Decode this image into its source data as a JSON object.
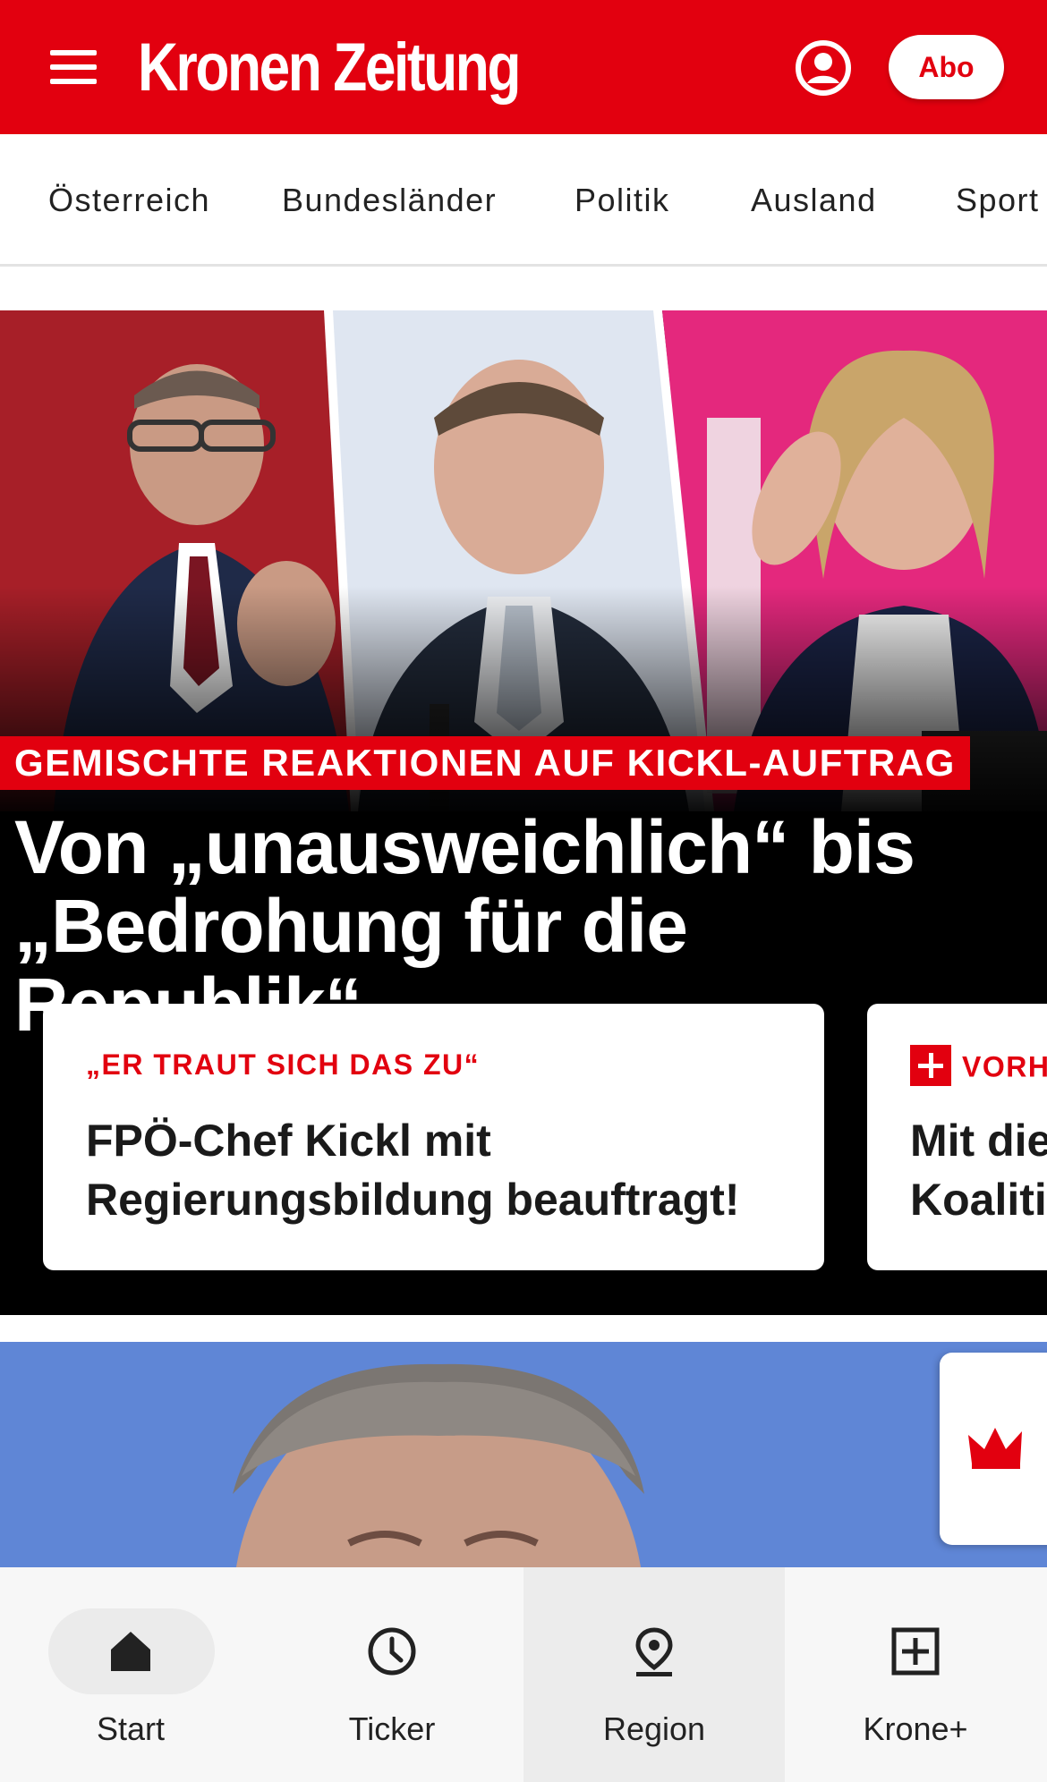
{
  "header": {
    "logo_text": "Kronen Zeitung",
    "abo_label": "Abo",
    "brand_color": "#e2000f",
    "menu_icon": "hamburger-menu-icon",
    "account_icon": "user-account-icon"
  },
  "section_nav": {
    "items": [
      "Österreich",
      "Bundesländer",
      "Politik",
      "Ausland",
      "Sport"
    ]
  },
  "hero": {
    "overline": "GEMISCHTE REAKTIONEN AUF KICKL-AUFTRAG",
    "title_line1": "Von „unausweichlich“ bis",
    "title_line2": "„Bedrohung für die Republik“",
    "cards": [
      {
        "kicker": "„ER TRAUT SICH DAS ZU“",
        "title_line1": "FPÖ-Chef Kickl mit",
        "title_line2": "Regierungsbildung beauftragt!"
      },
      {
        "kicker": "VORH",
        "title_line1": "Mit die",
        "title_line2": "Koaliti",
        "badge_icon": "krone-plus-icon"
      }
    ]
  },
  "article_2": {
    "image": "portrait-photo",
    "side_tab_icon": "krone-crown-icon"
  },
  "bottom_nav": {
    "items": [
      {
        "label": "Start",
        "icon": "home-icon"
      },
      {
        "label": "Ticker",
        "icon": "clock-icon"
      },
      {
        "label": "Region",
        "icon": "location-pin-icon"
      },
      {
        "label": "Krone+",
        "icon": "plus-box-icon"
      }
    ]
  }
}
